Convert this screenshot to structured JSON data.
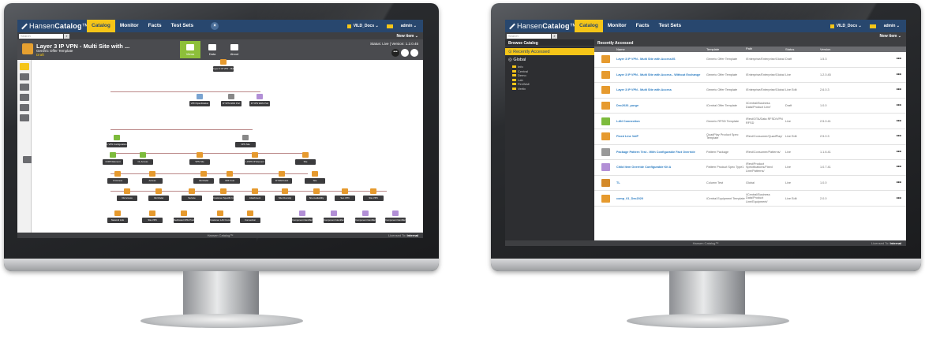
{
  "left": {
    "app": {
      "brand_a": "Hansen",
      "brand_b": "Catalog",
      "tm": "™"
    },
    "nav": {
      "catalog": "Catalog",
      "monitor": "Monitor",
      "facts": "Facts",
      "test_sets": "Test Sets",
      "close": "×"
    },
    "user": {
      "doc": "VILD_Docs ⌄",
      "user": "admin ⌄"
    },
    "search_placeholder": "Search",
    "new_item": "New item ⌄",
    "header": {
      "title": "Layer 3 IP VPN - Multi Site with ...",
      "subtitle": "Generic Offer Template",
      "state": "Draft",
      "status": "Status: Live | Version: 1.2.0.45",
      "tabs": [
        "Views",
        "Data",
        "About"
      ],
      "more": "•••"
    },
    "nodes": [
      "Layer 3 IP VPN - Multi Site with Access",
      "VPN Specification",
      "IP VPN WAN Port",
      "IP VPN WAN Port",
      "L VPN Configuration",
      "VPN Site",
      "COPN Element",
      "CL Access",
      "VPN Site",
      "L3VPN IP Element",
      "Site",
      "Cl Access",
      "Access",
      "CE Model",
      "VRF Cust",
      "IP WAN Host",
      "Site",
      "CE Access",
      "CE Model",
      "Service",
      "Customer Specific Information",
      "Attachment",
      "Site Diversity",
      "Site Availability",
      "Sec.VPN",
      "Site VPN",
      "Network Link",
      "Site VPN",
      "Dedicated CPE Product",
      "Customer LAN Connection",
      "Connection",
      "Component Identifier",
      "Component Identifier",
      "Component Identifier",
      "Component Identifier"
    ],
    "footer": {
      "brand": "Hansen Catalog™",
      "license_label": "Licensed To:",
      "license_value": "Internal"
    }
  },
  "right": {
    "app": {
      "brand_a": "Hansen",
      "brand_b": "Catalog",
      "tm": "™"
    },
    "nav": {
      "catalog": "Catalog",
      "monitor": "Monitor",
      "facts": "Facts",
      "test_sets": "Test Sets"
    },
    "user": {
      "doc": "VILD_Docs ⌄",
      "user": "admin ⌄"
    },
    "search_placeholder": "Search",
    "new_item": "New item ⌄",
    "browse": {
      "title": "Browse Catalog",
      "recent": "Recently Accessed",
      "global": "Global",
      "tree": [
        "Info",
        "Central",
        "Demo",
        "Lab",
        "FireWall",
        "Vertix"
      ]
    },
    "main": {
      "title": "Recently Accessed",
      "columns": [
        "Name",
        "Template",
        "Path",
        "Status",
        "Version"
      ],
      "rows": [
        {
          "name": "Layer 3 IP VPN - Multi Site with Access/IS",
          "template": "Generic Offer Template",
          "path": "/Enterprise/Enterprise/Global",
          "status": "Draft",
          "version": "1.5.3"
        },
        {
          "name": "Layer 3 IP VPN - Multi Site with Access - Without Exchange",
          "template": "Generic Offer Template",
          "path": "/Enterprise/Enterprise/Global",
          "status": "Live",
          "version": "1.2.0.45"
        },
        {
          "name": "Layer 3 IP VPN - Multi Site with Access",
          "template": "Generic Offer Template",
          "path": "/Enterprise/Enterprise/Global",
          "status": "Live Edit",
          "version": "2.6.0.3"
        },
        {
          "name": "Dec2020_purge",
          "template": "iCentral Offer Template",
          "path": "/iCentral/Business Data/Product Line/",
          "status": "Draft",
          "version": "1.0.0"
        },
        {
          "name": "LAN Connection",
          "template": "Generic RFSD Template",
          "path": "/Rest/OTA/Data RFSD/VPN RFSD",
          "status": "Live",
          "version": "2.5.0.41"
        },
        {
          "name": "Fixed Line VoIP",
          "template": "QuadPlay Product Spec Template",
          "path": "/Rest/Consumer/QuadPlay/",
          "status": "Live Edit",
          "version": "2.5.0.3"
        },
        {
          "name": "Package Pattern Test - With Configurable Fact Override",
          "template": "Pattern Package",
          "path": "/Rest/Consumer/Patterns/",
          "status": "Live",
          "version": "1.1.6.41"
        },
        {
          "name": "Child Item Override Configurable Kit A",
          "template": "Pattern Product Spec Type1",
          "path": "/Rest/Product Specifications/Fixed Line/Patterns/",
          "status": "Live",
          "version": "1.0.7.41"
        },
        {
          "name": "TL",
          "template": "Column Test",
          "path": "Global",
          "status": "Live",
          "version": "1.0.0"
        },
        {
          "name": "comp_01_Dec2020",
          "template": "iCentral Equipment Template",
          "path": "/iCentral/Business Data/Product Line/Equipment/",
          "status": "Live Edit",
          "version": "2.0.0"
        }
      ]
    },
    "footer": {
      "brand": "Hansen Catalog™",
      "license_label": "Licensed To:",
      "license_value": "Internal"
    },
    "row_more": "•••",
    "icon_colors": [
      "#e69a2e",
      "#e69a2e",
      "#e69a2e",
      "#e69a2e",
      "#7dbb3c",
      "#e69a2e",
      "#999999",
      "#b28fd6",
      "#d48a2a",
      "#e69a2e"
    ]
  }
}
